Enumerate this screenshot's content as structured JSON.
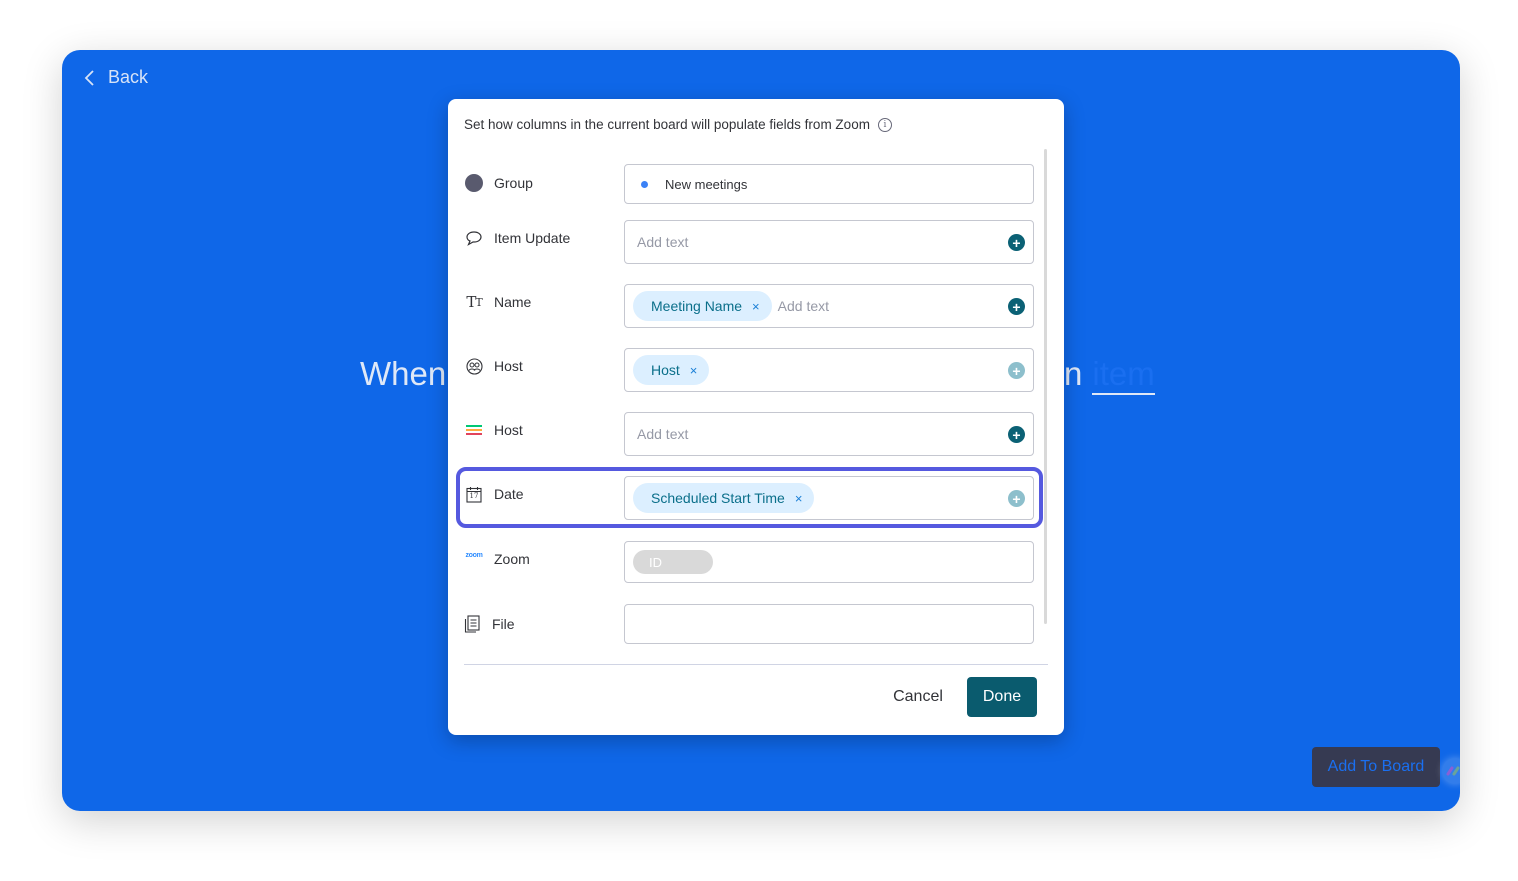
{
  "back": {
    "label": "Back"
  },
  "background": {
    "sentence_start": "When",
    "sentence_end": "n",
    "item_link": "item",
    "add_to_board_label": "Add To Board"
  },
  "modal": {
    "description": "Set how columns in the current board will populate fields from Zoom",
    "info_icon": "i",
    "rows": [
      {
        "label": "Group",
        "icon": "group-dot-icon",
        "value": "New meetings"
      },
      {
        "label": "Item Update",
        "icon": "speech-bubble-icon",
        "placeholder": "Add text"
      },
      {
        "label": "Name",
        "icon": "text-type-icon",
        "chips": [
          "Meeting Name"
        ],
        "placeholder": "Add text"
      },
      {
        "label": "Host",
        "icon": "people-icon",
        "chips": [
          "Host"
        ]
      },
      {
        "label": "Host",
        "icon": "status-lines-icon",
        "placeholder": "Add text"
      },
      {
        "label": "Date",
        "icon": "calendar-icon",
        "chips": [
          "Scheduled Start Time"
        ],
        "calendar_day": "17"
      },
      {
        "label": "Zoom",
        "icon": "zoom-logo-icon",
        "logo_text": "zoom",
        "pill": "ID"
      },
      {
        "label": "File",
        "icon": "file-icon"
      }
    ],
    "chip_remove": "×",
    "plus": "+",
    "cancel_label": "Cancel",
    "done_label": "Done"
  },
  "colors": {
    "background_blue": "#0f67e8",
    "highlight": "#5559df",
    "done_button": "#0a5b6e",
    "chip_bg": "#dcefff",
    "chip_text": "#0a6f8a"
  }
}
